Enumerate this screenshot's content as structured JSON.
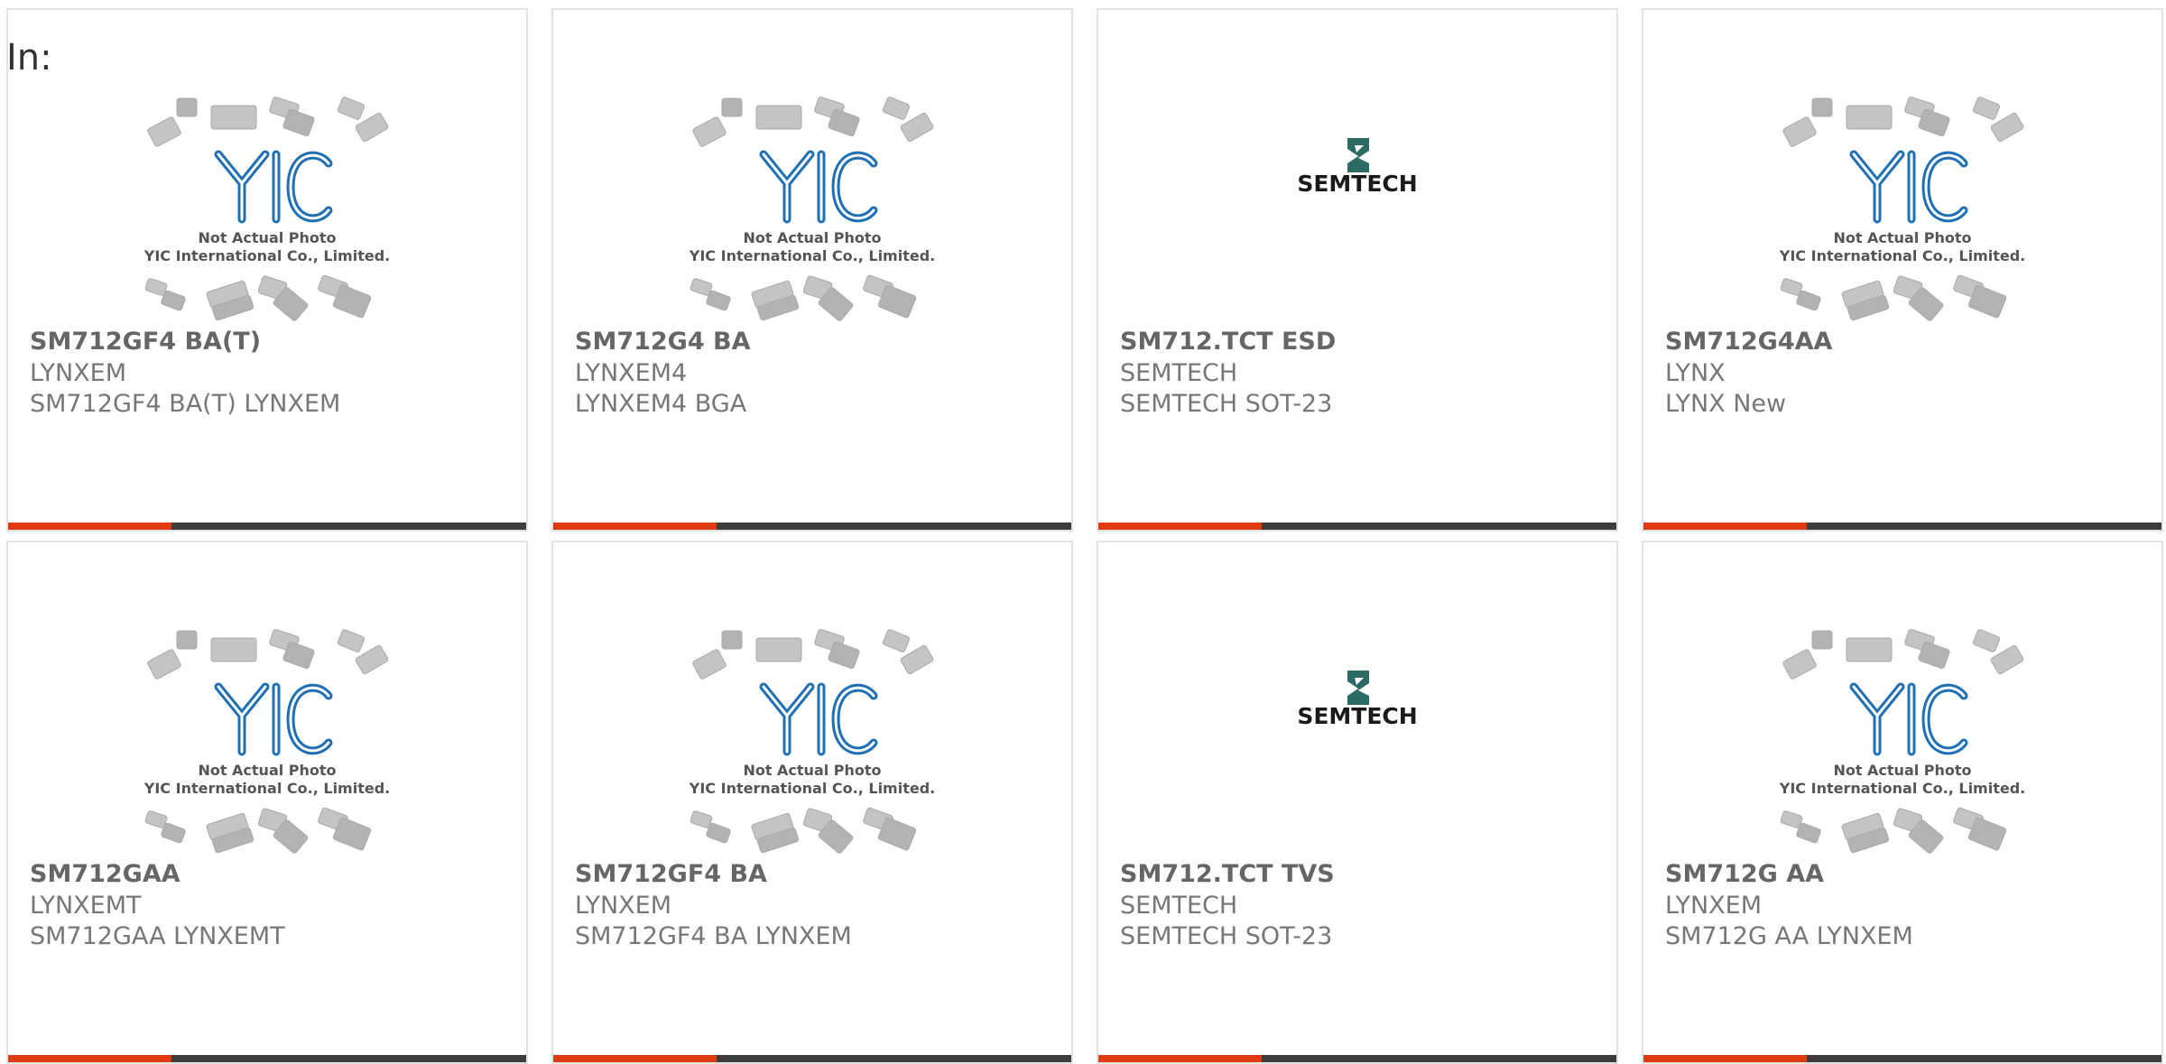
{
  "header": {
    "label": "In:"
  },
  "colors": {
    "accent": "#e03a12",
    "bar": "#3d3d3d",
    "yic_blue": "#1f6fb5"
  },
  "image_caption": {
    "line1": "Not Actual Photo",
    "line2": "YIC International Co., Limited."
  },
  "semtech_logo_text": "SEMTECH",
  "products": [
    {
      "part": "SM712GF4 BA(T)",
      "brand": "LYNXEM",
      "desc": "SM712GF4 BA(T) LYNXEM",
      "image": "yic-placeholder"
    },
    {
      "part": "SM712G4 BA",
      "brand": "LYNXEM4",
      "desc": "LYNXEM4 BGA",
      "image": "yic-placeholder"
    },
    {
      "part": "SM712.TCT ESD",
      "brand": "SEMTECH",
      "desc": "SEMTECH SOT-23",
      "image": "semtech-logo"
    },
    {
      "part": "SM712G4AA",
      "brand": "LYNX",
      "desc": "LYNX New",
      "image": "yic-placeholder"
    },
    {
      "part": "SM712GAA",
      "brand": "LYNXEMT",
      "desc": "SM712GAA LYNXEMT",
      "image": "yic-placeholder"
    },
    {
      "part": "SM712GF4 BA",
      "brand": "LYNXEM",
      "desc": "SM712GF4 BA LYNXEM",
      "image": "yic-placeholder"
    },
    {
      "part": "SM712.TCT TVS",
      "brand": "SEMTECH",
      "desc": "SEMTECH SOT-23",
      "image": "semtech-logo"
    },
    {
      "part": "SM712G AA",
      "brand": "LYNXEM",
      "desc": "SM712G AA LYNXEM",
      "image": "yic-placeholder"
    }
  ]
}
